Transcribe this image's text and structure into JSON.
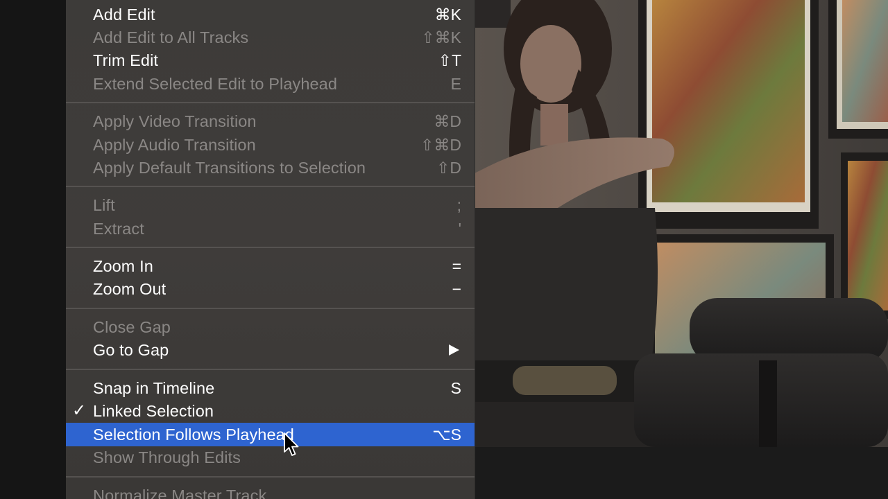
{
  "menu": {
    "groups": [
      {
        "items": [
          {
            "label": "Add Edit",
            "shortcut": "⌘K",
            "enabled": true
          },
          {
            "label": "Add Edit to All Tracks",
            "shortcut": "⇧⌘K",
            "enabled": false
          },
          {
            "label": "Trim Edit",
            "shortcut": "⇧T",
            "enabled": true
          },
          {
            "label": "Extend Selected Edit to Playhead",
            "shortcut": "E",
            "enabled": false
          }
        ]
      },
      {
        "items": [
          {
            "label": "Apply Video Transition",
            "shortcut": "⌘D",
            "enabled": false
          },
          {
            "label": "Apply Audio Transition",
            "shortcut": "⇧⌘D",
            "enabled": false
          },
          {
            "label": "Apply Default Transitions to Selection",
            "shortcut": "⇧D",
            "enabled": false
          }
        ]
      },
      {
        "items": [
          {
            "label": "Lift",
            "shortcut": ";",
            "enabled": false
          },
          {
            "label": "Extract",
            "shortcut": "'",
            "enabled": false
          }
        ]
      },
      {
        "items": [
          {
            "label": "Zoom In",
            "shortcut": "=",
            "enabled": true
          },
          {
            "label": "Zoom Out",
            "shortcut": "−",
            "enabled": true
          }
        ]
      },
      {
        "items": [
          {
            "label": "Close Gap",
            "shortcut": "",
            "enabled": false
          },
          {
            "label": "Go to Gap",
            "shortcut": "",
            "enabled": true,
            "submenu": true
          }
        ]
      },
      {
        "items": [
          {
            "label": "Snap in Timeline",
            "shortcut": "S",
            "enabled": true
          },
          {
            "label": "Linked Selection",
            "shortcut": "",
            "enabled": true,
            "checked": true
          },
          {
            "label": "Selection Follows Playhead",
            "shortcut": "⌥S",
            "enabled": true,
            "highlighted": true
          },
          {
            "label": "Show Through Edits",
            "shortcut": "",
            "enabled": false
          }
        ]
      },
      {
        "items": [
          {
            "label": "Normalize Master Track",
            "shortcut": "",
            "enabled": false
          }
        ]
      }
    ],
    "check_glyph": "✓",
    "submenu_icon": "triangle-right-icon",
    "highlight_color": "#2e64d0"
  },
  "video_preview": {
    "description_icon": "video-frame-image"
  }
}
